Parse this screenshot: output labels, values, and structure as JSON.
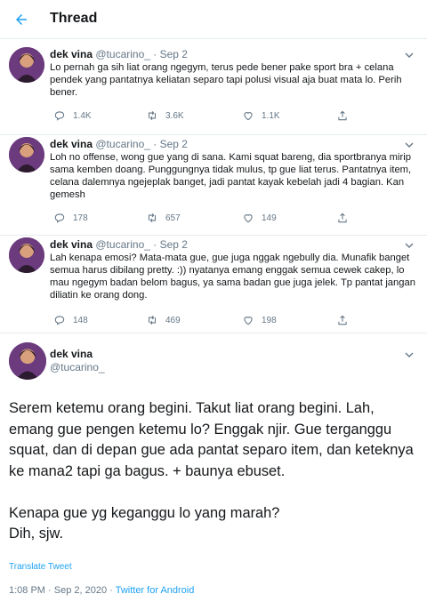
{
  "header": {
    "title": "Thread",
    "back_icon": "arrow-left-icon",
    "accent": "#1da1f2"
  },
  "replies": [
    {
      "name": "dek vina",
      "handle": "@tucarino_",
      "separator": "·",
      "date": "Sep 2",
      "text": "Lo pernah ga sih liat orang ngegym, terus pede bener pake sport bra + celana pendek yang pantatnya keliatan separo tapi polusi visual aja buat mata lo. Perih bener.",
      "reply_count": "1.4K",
      "retweet_count": "3.6K",
      "like_count": "1.1K"
    },
    {
      "name": "dek vina",
      "handle": "@tucarino_",
      "separator": "·",
      "date": "Sep 2",
      "text": "Loh no offense, wong gue yang di sana. Kami squat bareng, dia sportbranya mirip sama kemben doang. Punggungnya tidak mulus, tp gue liat terus. Pantatnya item, celana dalemnya ngejeplak banget, jadi pantat kayak kebelah jadi 4 bagian. Kan gemesh",
      "reply_count": "178",
      "retweet_count": "657",
      "like_count": "149"
    },
    {
      "name": "dek vina",
      "handle": "@tucarino_",
      "separator": "·",
      "date": "Sep 2",
      "text": "Lah kenapa emosi? Mata-mata gue, gue juga nggak ngebully dia. Munafik banget semua harus dibilang pretty. :)) nyatanya emang enggak semua cewek cakep, lo mau ngegym badan belom bagus, ya sama badan gue juga jelek. Tp pantat jangan diliatin ke orang dong.",
      "reply_count": "148",
      "retweet_count": "469",
      "like_count": "198"
    }
  ],
  "main_tweet": {
    "name": "dek vina",
    "handle": "@tucarino_",
    "paragraph_1": "Serem ketemu orang begini. Takut liat orang begini. Lah, emang gue pengen ketemu lo? Enggak njir. Gue terganggu squat, dan di depan gue ada pantat separo item, dan keteknya ke mana2 tapi ga bagus. + baunya ebuset.",
    "paragraph_2": "Kenapa gue yg keganggu lo yang marah?",
    "paragraph_3": "Dih, sjw.",
    "translate_label": "Translate Tweet",
    "time": "1:08 PM",
    "separator": "·",
    "full_date": "Sep 2, 2020",
    "client": "Twitter for Android"
  },
  "icons": [
    "arrow-left-icon",
    "chevron-down-icon",
    "reply-icon",
    "retweet-icon",
    "like-icon",
    "share-icon",
    "avatar"
  ]
}
